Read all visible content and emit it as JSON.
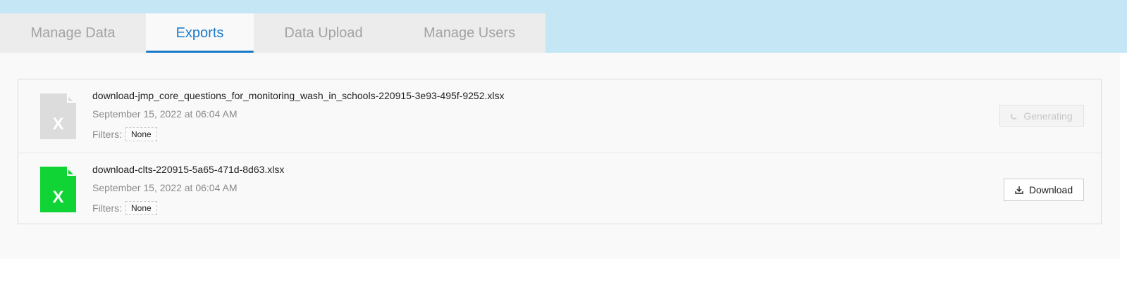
{
  "tabs": [
    {
      "label": "Manage Data",
      "active": false
    },
    {
      "label": "Exports",
      "active": true
    },
    {
      "label": "Data Upload",
      "active": false
    },
    {
      "label": "Manage Users",
      "active": false
    }
  ],
  "exports": [
    {
      "file_name": "download-jmp_core_questions_for_monitoring_wash_in_schools-220915-3e93-495f-9252.xlsx",
      "date": "September 15, 2022 at 06:04 AM",
      "filters_label": "Filters:",
      "filter_value": "None",
      "status": "Generating",
      "icon": "excel-file-icon",
      "icon_color": "#dcdcdc"
    },
    {
      "file_name": "download-clts-220915-5a65-471d-8d63.xlsx",
      "date": "September 15, 2022 at 06:04 AM",
      "filters_label": "Filters:",
      "filter_value": "None",
      "action_label": "Download",
      "icon": "excel-file-icon",
      "icon_color": "#10d436"
    }
  ],
  "colors": {
    "accent": "#1a7ac9",
    "top_band": "#c4e6f5",
    "tab_bar": "#ececec"
  }
}
